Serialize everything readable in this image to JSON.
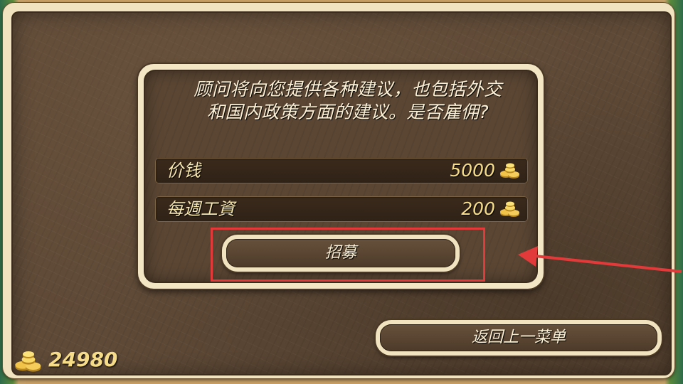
{
  "dialog": {
    "message_line1": "顾问将向您提供各种建议，也包括外交",
    "message_line2": "和国内政策方面的建议。是否雇佣?",
    "rows": [
      {
        "label": "价钱",
        "value": "5000",
        "icon": "gold-coins-icon"
      },
      {
        "label": "每週工資",
        "value": "200",
        "icon": "gold-coins-icon"
      }
    ],
    "recruit_label": "招募"
  },
  "footer": {
    "back_label": "返回上一菜单",
    "treasury": "24980",
    "treasury_icon": "gold-coins-icon"
  },
  "annotation": {
    "highlight_color": "#e23a3a"
  },
  "colors": {
    "panel_brown": "#5f4a37",
    "frame_cream": "#f1e3bf",
    "text_gold": "#f6dc88"
  }
}
